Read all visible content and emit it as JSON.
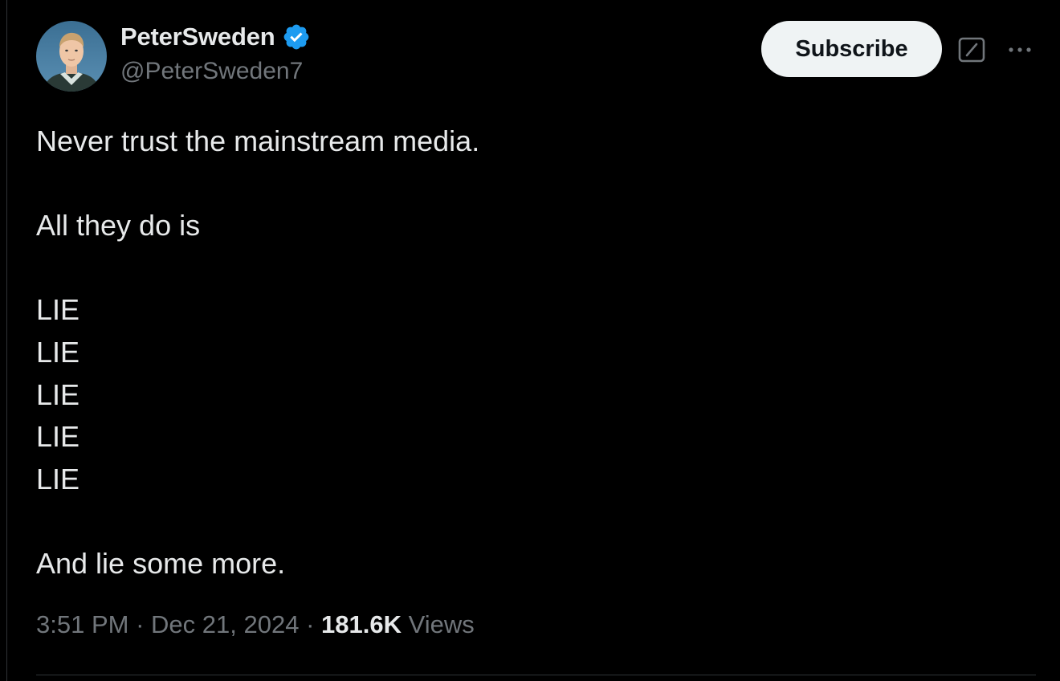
{
  "author": {
    "display_name": "PeterSweden",
    "handle": "@PeterSweden7",
    "verified": true,
    "verified_color": "#1d9bf0",
    "avatar_icon": "profile-photo"
  },
  "actions": {
    "subscribe_label": "Subscribe",
    "grok_icon": "grok-icon",
    "more_icon": "more-icon"
  },
  "tweet": {
    "lines": [
      "Never trust the mainstream media.",
      "",
      "All they do is",
      "",
      "LIE",
      "LIE",
      "LIE",
      "LIE",
      "LIE",
      "",
      "And lie some more."
    ]
  },
  "meta": {
    "time": "3:51 PM",
    "separator": "·",
    "date": "Dec 21, 2024",
    "views_count": "181.6K",
    "views_label": "Views"
  },
  "colors": {
    "background": "#000000",
    "text_primary": "#e7e9ea",
    "text_secondary": "#71767b",
    "button_bg": "#eff3f4",
    "divider": "#2f3336"
  }
}
